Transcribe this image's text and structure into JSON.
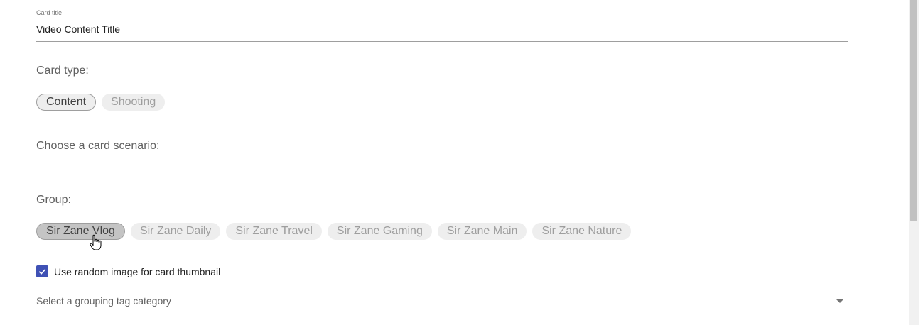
{
  "card_title": {
    "label": "Card title",
    "value": "Video Content Title"
  },
  "card_type": {
    "label": "Card type:",
    "options": [
      "Content",
      "Shooting"
    ],
    "selected": "Content"
  },
  "scenario": {
    "label": "Choose a card scenario:"
  },
  "group": {
    "label": "Group:",
    "options": [
      "Sir Zane Vlog",
      "Sir Zane Daily",
      "Sir Zane Travel",
      "Sir Zane Gaming",
      "Sir Zane Main",
      "Sir Zane Nature"
    ],
    "selected": "Sir Zane Vlog"
  },
  "random_image": {
    "label": "Use random image for card thumbnail",
    "checked": true
  },
  "grouping_tag": {
    "placeholder": "Select a grouping tag category"
  },
  "colors": {
    "checkbox": "#3f51b5",
    "chip": "#eeeeee",
    "chip_selected": "#c4c4c4"
  }
}
